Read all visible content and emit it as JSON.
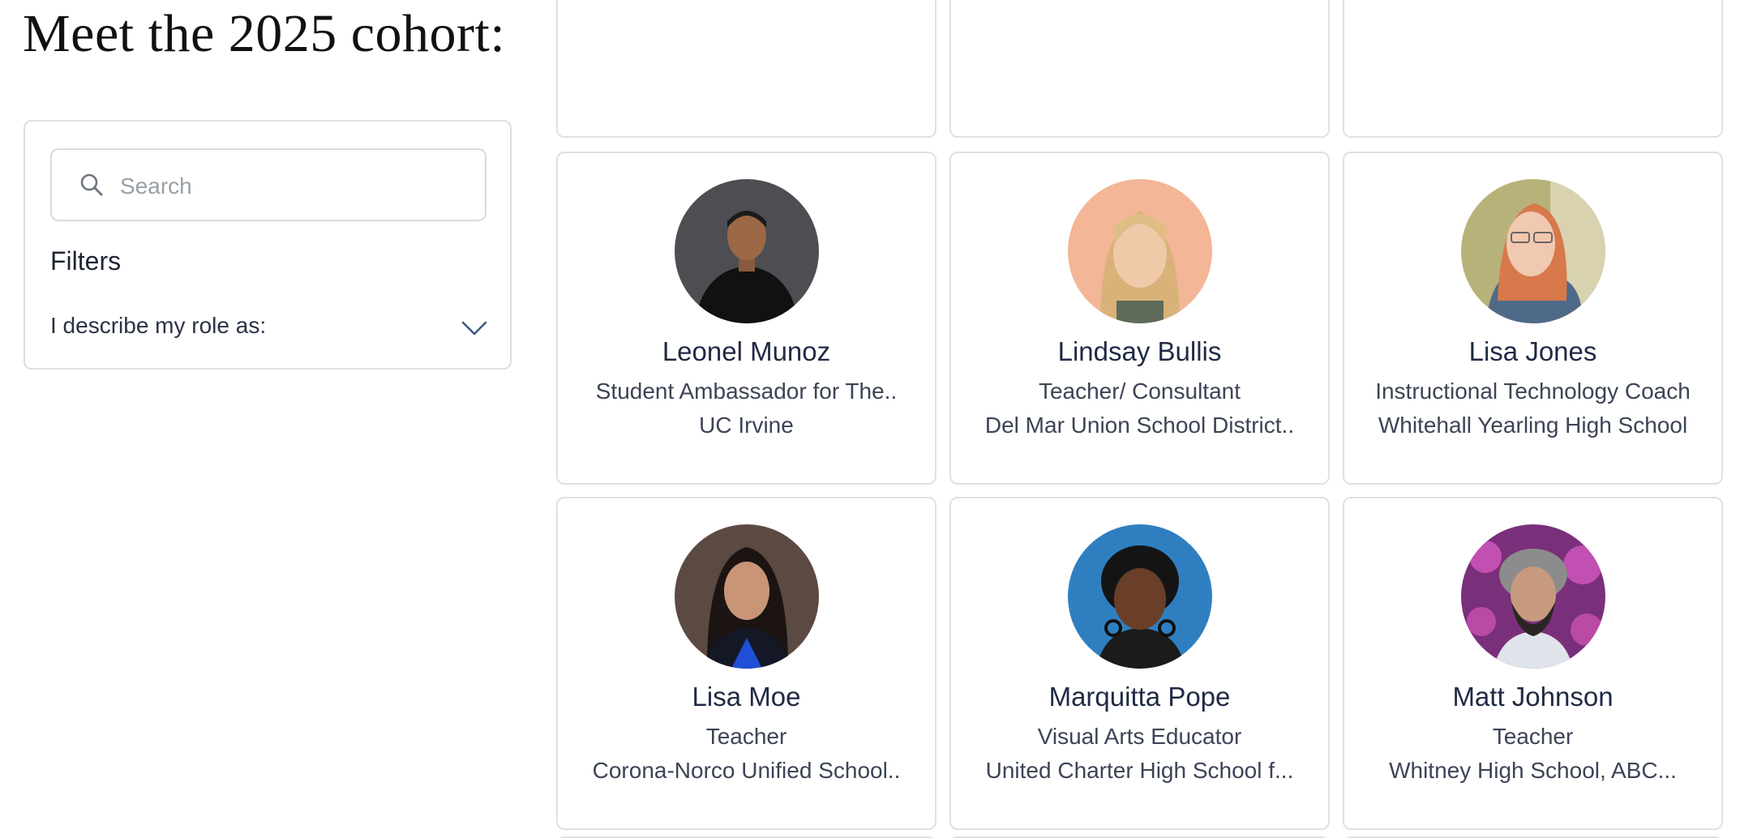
{
  "page": {
    "title": "Meet the 2025 cohort:"
  },
  "sidebar": {
    "search": {
      "placeholder": "Search",
      "value": ""
    },
    "filters_heading": "Filters",
    "role_filter_label": "I describe my role as:"
  },
  "members": [
    {
      "name": "Leonel Munoz",
      "role": "Student Ambassador for The..",
      "org": "UC Irvine",
      "avatar": "photo-man-dark-shirt",
      "avatar_bg": "#4a4a4e"
    },
    {
      "name": "Lindsay Bullis",
      "role": "Teacher/ Consultant",
      "org": "Del Mar Union School District..",
      "avatar": "photo-woman-blonde",
      "avatar_bg": "#f2b89a"
    },
    {
      "name": "Lisa Jones",
      "role": "Instructional Technology Coach",
      "org": "Whitehall Yearling High School",
      "avatar": "photo-woman-redhead-outdoor",
      "avatar_bg": "#a8a06a"
    },
    {
      "name": "Lisa Moe",
      "role": "Teacher",
      "org": "Corona-Norco Unified School..",
      "avatar": "photo-woman-dark-hair",
      "avatar_bg": "#5a4a42"
    },
    {
      "name": "Marquitta Pope",
      "role": "Visual Arts Educator",
      "org": "United Charter High School f...",
      "avatar": "photo-woman-blue-backdrop",
      "avatar_bg": "#2f7fc0"
    },
    {
      "name": "Matt Johnson",
      "role": "Teacher",
      "org": "Whitney High School, ABC...",
      "avatar": "photo-man-flowers",
      "avatar_bg": "#8a3a8a"
    }
  ]
}
